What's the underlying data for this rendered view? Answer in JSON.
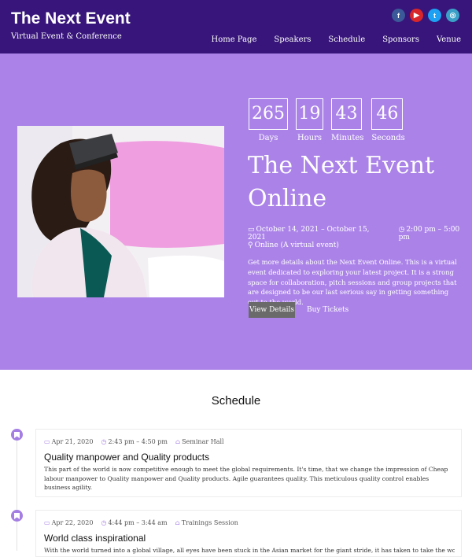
{
  "header": {
    "brand": "The Next Event",
    "tagline": "Virtual Event & Conference",
    "socials": [
      {
        "name": "facebook-icon",
        "glyph": "f",
        "color": "#3b5998"
      },
      {
        "name": "youtube-icon",
        "glyph": "▶",
        "color": "#d8262a"
      },
      {
        "name": "twitter-icon",
        "glyph": "t",
        "color": "#1da1f2"
      },
      {
        "name": "instagram-icon",
        "glyph": "◎",
        "color": "#3aa0c7"
      }
    ],
    "nav": [
      "Home Page",
      "Speakers",
      "Schedule",
      "Sponsors",
      "Venue"
    ],
    "bg_color": "#37157a"
  },
  "hero": {
    "bg_color": "#ab83e8",
    "countdown": [
      {
        "value": "265",
        "label": "Days"
      },
      {
        "value": "19",
        "label": "Hours"
      },
      {
        "value": "43",
        "label": "Minutes"
      },
      {
        "value": "46",
        "label": "Seconds"
      }
    ],
    "title": "The Next Event Online",
    "date_range": "October 14, 2021 – October 15, 2021",
    "time_range": "2:00 pm – 5:00 pm",
    "location": "Online (A virtual event)",
    "description": "Get more details about the Next Event Online. This is a virtual event dedicated to exploring your latest project. It is a strong space for collaboration, pitch sessions and group projects that are designed to be our last serious say in getting something out to the world.",
    "details_button": "View Details",
    "tickets_button": "Buy Tickets"
  },
  "schedule": {
    "title": "Schedule",
    "accent_color": "#a47ee3",
    "items": [
      {
        "date": "Apr 21, 2020",
        "time": "2:43 pm – 4:50 pm",
        "venue": "Seminar Hall",
        "title": "Quality manpower and Quality products",
        "description": "This part of the world is now competitive enough to meet the global requirements. It's time, that we change the impression of Cheap labour manpower to Quality manpower and Quality products. Agile guarantees quality. This meticulous quality control enables business agility."
      },
      {
        "date": "Apr 22, 2020",
        "time": "4:44 pm – 3:44 am",
        "venue": "Trainings Session",
        "title": "World class inspirational",
        "description": "With the world turned into a global village, all eyes have been stuck in the Asian market for the giant stride, it has taken to take the world market by"
      }
    ]
  }
}
